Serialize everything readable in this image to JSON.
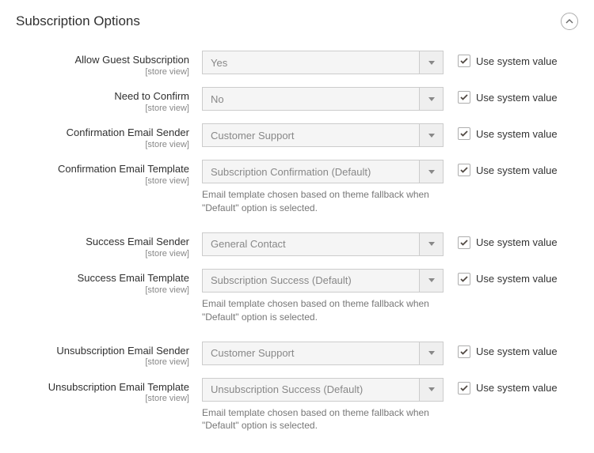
{
  "section": {
    "title": "Subscription Options"
  },
  "use_system_label": "Use system value",
  "scope_label": "[store view]",
  "template_note": "Email template chosen based on theme fallback when \"Default\" option is selected.",
  "fields": {
    "allow_guest": {
      "label": "Allow Guest Subscription",
      "value": "Yes"
    },
    "need_confirm": {
      "label": "Need to Confirm",
      "value": "No"
    },
    "confirm_sender": {
      "label": "Confirmation Email Sender",
      "value": "Customer Support"
    },
    "confirm_template": {
      "label": "Confirmation Email Template",
      "value": "Subscription Confirmation (Default)"
    },
    "success_sender": {
      "label": "Success Email Sender",
      "value": "General Contact"
    },
    "success_template": {
      "label": "Success Email Template",
      "value": "Subscription Success (Default)"
    },
    "unsub_sender": {
      "label": "Unsubscription Email Sender",
      "value": "Customer Support"
    },
    "unsub_template": {
      "label": "Unsubscription Email Template",
      "value": "Unsubscription Success (Default)"
    }
  }
}
